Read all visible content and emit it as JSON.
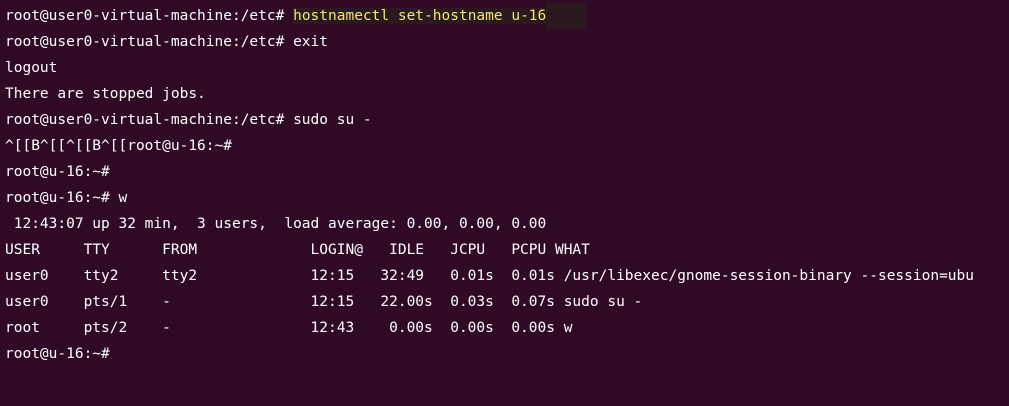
{
  "terminal": {
    "lines": [
      {
        "prompt": "root@user0-virtual-machine:/etc# ",
        "command": "hostnamectl set-hostname u-16"
      },
      {
        "text": "root@user0-virtual-machine:/etc# exit"
      },
      {
        "text": "logout"
      },
      {
        "text": "There are stopped jobs."
      },
      {
        "text": "root@user0-virtual-machine:/etc# sudo su -"
      },
      {
        "text": "^[[B^[[^[[B^[[root@u-16:~#"
      },
      {
        "text": "root@u-16:~#"
      },
      {
        "text": "root@u-16:~# w"
      },
      {
        "text": " 12:43:07 up 32 min,  3 users,  load average: 0.00, 0.00, 0.00"
      },
      {
        "text": "USER     TTY      FROM             LOGIN@   IDLE   JCPU   PCPU WHAT"
      },
      {
        "text": "user0    tty2     tty2             12:15   32:49   0.01s  0.01s /usr/libexec/gnome-session-binary --session=ubu"
      },
      {
        "text": "user0    pts/1    -                12:15   22.00s  0.03s  0.07s sudo su -"
      },
      {
        "text": "root     pts/2    -                12:43    0.00s  0.00s  0.00s w"
      },
      {
        "text": "root@u-16:~#"
      }
    ]
  },
  "colors": {
    "background": "#300a24",
    "text": "#ffffff",
    "highlight_text": "#f4e66a"
  }
}
